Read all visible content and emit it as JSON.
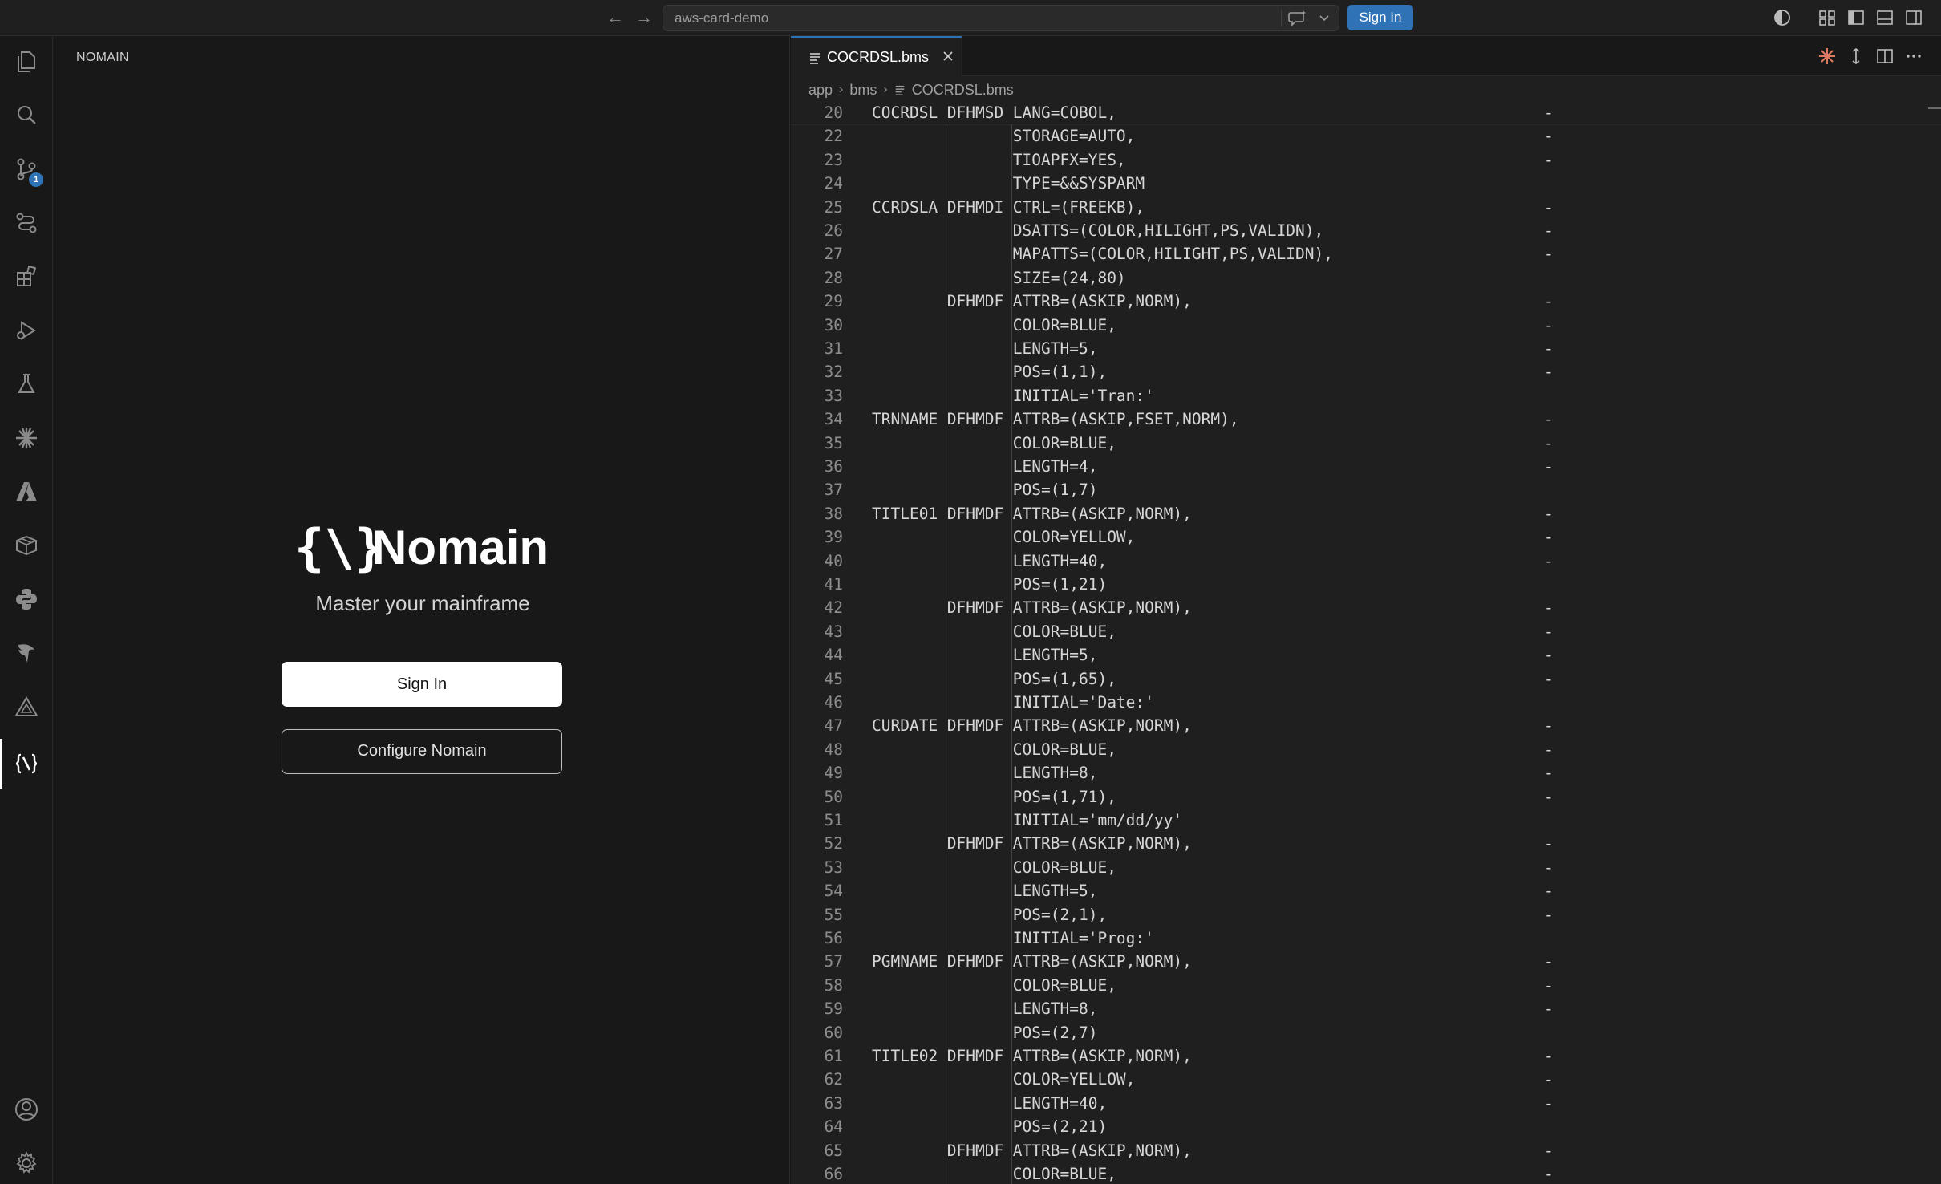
{
  "titlebar": {
    "back_icon": "arrow-left-icon",
    "forward_icon": "arrow-right-icon",
    "search_text": "aws-card-demo",
    "chat_icon": "chat-sparkle-icon",
    "sign_in_label": "Sign In"
  },
  "activity_bar": {
    "items": [
      "files-icon",
      "search-icon",
      "source-control-icon",
      "remote-explorer-icon",
      "extensions-icon",
      "run-debug-icon",
      "testing-icon",
      "sparkle-icon",
      "azure-icon",
      "package-icon",
      "python-icon",
      "bird-icon",
      "triangle-icon",
      "nomain-icon"
    ],
    "source_control_badge": "1",
    "bottom": [
      "account-icon",
      "settings-gear-icon"
    ]
  },
  "sidebar": {
    "title": "NOMAIN",
    "logo_glyph": "{\\}",
    "logo_text": "Nomain",
    "tagline": "Master your mainframe",
    "sign_in_label": "Sign In",
    "configure_label": "Configure Nomain"
  },
  "editor": {
    "tab_label": "COCRDSL.bms",
    "breadcrumb": [
      "app",
      "bms",
      "COCRDSL.bms"
    ],
    "continuation_char": "-",
    "lines": [
      {
        "n": "20",
        "label": "COCRDSL",
        "op": "DFHMSD",
        "arg": "LANG=COBOL,",
        "cont": true
      },
      {
        "n": "22",
        "label": "",
        "op": "",
        "arg": "STORAGE=AUTO,",
        "cont": true
      },
      {
        "n": "23",
        "label": "",
        "op": "",
        "arg": "TIOAPFX=YES,",
        "cont": true
      },
      {
        "n": "24",
        "label": "",
        "op": "",
        "arg": "TYPE=&&SYSPARM",
        "cont": false
      },
      {
        "n": "25",
        "label": "CCRDSLA",
        "op": "DFHMDI",
        "arg": "CTRL=(FREEKB),",
        "cont": true
      },
      {
        "n": "26",
        "label": "",
        "op": "",
        "arg": "DSATTS=(COLOR,HILIGHT,PS,VALIDN),",
        "cont": true
      },
      {
        "n": "27",
        "label": "",
        "op": "",
        "arg": "MAPATTS=(COLOR,HILIGHT,PS,VALIDN),",
        "cont": true
      },
      {
        "n": "28",
        "label": "",
        "op": "",
        "arg": "SIZE=(24,80)",
        "cont": false
      },
      {
        "n": "29",
        "label": "",
        "op": "DFHMDF",
        "arg": "ATTRB=(ASKIP,NORM),",
        "cont": true
      },
      {
        "n": "30",
        "label": "",
        "op": "",
        "arg": "COLOR=BLUE,",
        "cont": true
      },
      {
        "n": "31",
        "label": "",
        "op": "",
        "arg": "LENGTH=5,",
        "cont": true
      },
      {
        "n": "32",
        "label": "",
        "op": "",
        "arg": "POS=(1,1),",
        "cont": true
      },
      {
        "n": "33",
        "label": "",
        "op": "",
        "arg": "INITIAL='Tran:'",
        "cont": false
      },
      {
        "n": "34",
        "label": "TRNNAME",
        "op": "DFHMDF",
        "arg": "ATTRB=(ASKIP,FSET,NORM),",
        "cont": true
      },
      {
        "n": "35",
        "label": "",
        "op": "",
        "arg": "COLOR=BLUE,",
        "cont": true
      },
      {
        "n": "36",
        "label": "",
        "op": "",
        "arg": "LENGTH=4,",
        "cont": true
      },
      {
        "n": "37",
        "label": "",
        "op": "",
        "arg": "POS=(1,7)",
        "cont": false
      },
      {
        "n": "38",
        "label": "TITLE01",
        "op": "DFHMDF",
        "arg": "ATTRB=(ASKIP,NORM),",
        "cont": true
      },
      {
        "n": "39",
        "label": "",
        "op": "",
        "arg": "COLOR=YELLOW,",
        "cont": true
      },
      {
        "n": "40",
        "label": "",
        "op": "",
        "arg": "LENGTH=40,",
        "cont": true
      },
      {
        "n": "41",
        "label": "",
        "op": "",
        "arg": "POS=(1,21)",
        "cont": false
      },
      {
        "n": "42",
        "label": "",
        "op": "DFHMDF",
        "arg": "ATTRB=(ASKIP,NORM),",
        "cont": true
      },
      {
        "n": "43",
        "label": "",
        "op": "",
        "arg": "COLOR=BLUE,",
        "cont": true
      },
      {
        "n": "44",
        "label": "",
        "op": "",
        "arg": "LENGTH=5,",
        "cont": true
      },
      {
        "n": "45",
        "label": "",
        "op": "",
        "arg": "POS=(1,65),",
        "cont": true
      },
      {
        "n": "46",
        "label": "",
        "op": "",
        "arg": "INITIAL='Date:'",
        "cont": false
      },
      {
        "n": "47",
        "label": "CURDATE",
        "op": "DFHMDF",
        "arg": "ATTRB=(ASKIP,NORM),",
        "cont": true
      },
      {
        "n": "48",
        "label": "",
        "op": "",
        "arg": "COLOR=BLUE,",
        "cont": true
      },
      {
        "n": "49",
        "label": "",
        "op": "",
        "arg": "LENGTH=8,",
        "cont": true
      },
      {
        "n": "50",
        "label": "",
        "op": "",
        "arg": "POS=(1,71),",
        "cont": true
      },
      {
        "n": "51",
        "label": "",
        "op": "",
        "arg": "INITIAL='mm/dd/yy'",
        "cont": false
      },
      {
        "n": "52",
        "label": "",
        "op": "DFHMDF",
        "arg": "ATTRB=(ASKIP,NORM),",
        "cont": true
      },
      {
        "n": "53",
        "label": "",
        "op": "",
        "arg": "COLOR=BLUE,",
        "cont": true
      },
      {
        "n": "54",
        "label": "",
        "op": "",
        "arg": "LENGTH=5,",
        "cont": true
      },
      {
        "n": "55",
        "label": "",
        "op": "",
        "arg": "POS=(2,1),",
        "cont": true
      },
      {
        "n": "56",
        "label": "",
        "op": "",
        "arg": "INITIAL='Prog:'",
        "cont": false
      },
      {
        "n": "57",
        "label": "PGMNAME",
        "op": "DFHMDF",
        "arg": "ATTRB=(ASKIP,NORM),",
        "cont": true
      },
      {
        "n": "58",
        "label": "",
        "op": "",
        "arg": "COLOR=BLUE,",
        "cont": true
      },
      {
        "n": "59",
        "label": "",
        "op": "",
        "arg": "LENGTH=8,",
        "cont": true
      },
      {
        "n": "60",
        "label": "",
        "op": "",
        "arg": "POS=(2,7)",
        "cont": false
      },
      {
        "n": "61",
        "label": "TITLE02",
        "op": "DFHMDF",
        "arg": "ATTRB=(ASKIP,NORM),",
        "cont": true
      },
      {
        "n": "62",
        "label": "",
        "op": "",
        "arg": "COLOR=YELLOW,",
        "cont": true
      },
      {
        "n": "63",
        "label": "",
        "op": "",
        "arg": "LENGTH=40,",
        "cont": true
      },
      {
        "n": "64",
        "label": "",
        "op": "",
        "arg": "POS=(2,21)",
        "cont": false
      },
      {
        "n": "65",
        "label": "",
        "op": "DFHMDF",
        "arg": "ATTRB=(ASKIP,NORM),",
        "cont": true
      },
      {
        "n": "66",
        "label": "",
        "op": "",
        "arg": "COLOR=BLUE,",
        "cont": true
      }
    ]
  },
  "colors": {
    "accent": "#2f72b5",
    "background": "#181818",
    "editor_background": "#1f1f1f"
  }
}
